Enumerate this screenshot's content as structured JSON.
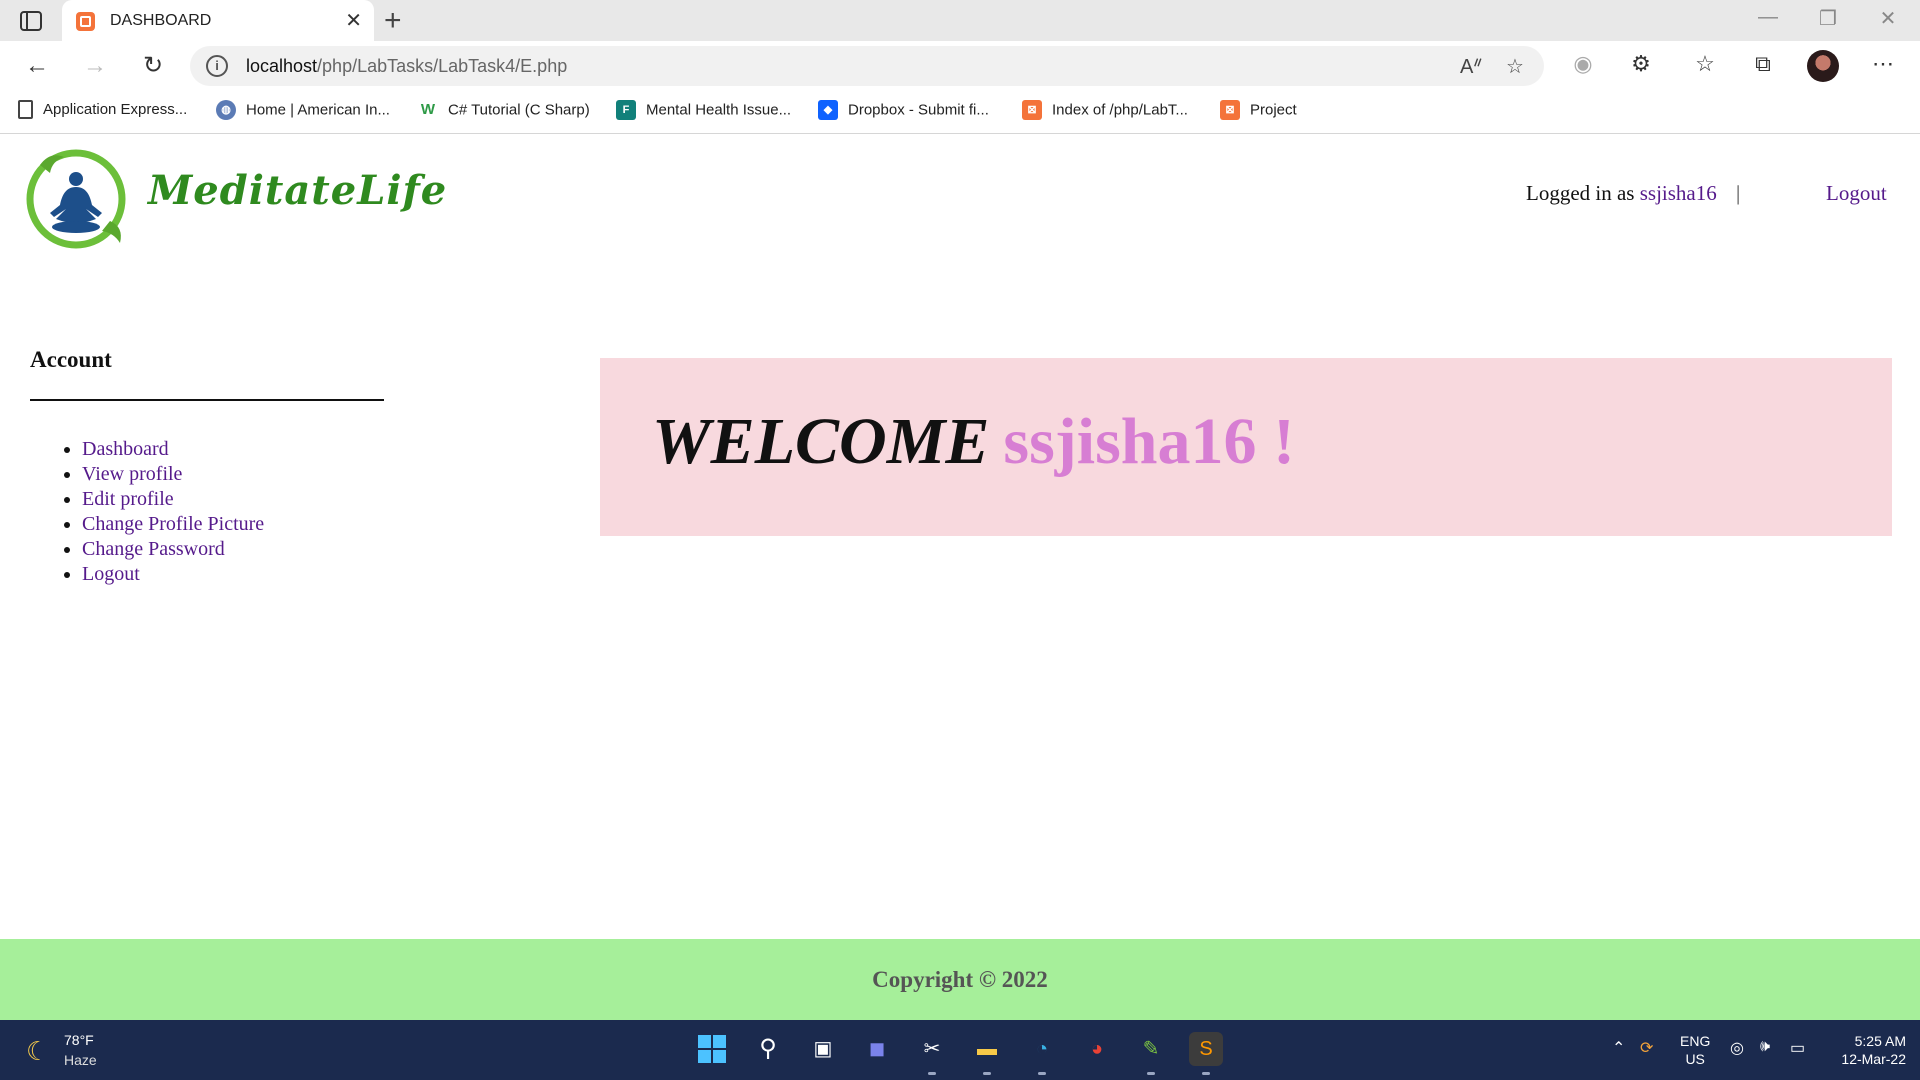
{
  "browser": {
    "tab_title": "DASHBOARD",
    "url_host": "localhost",
    "url_path": "/php/LabTasks/LabTask4/E.php",
    "bookmarks": [
      {
        "label": "Application Express...",
        "icon": "page-icon"
      },
      {
        "label": "Home | American In...",
        "icon": "globe-icon"
      },
      {
        "label": "C# Tutorial (C Sharp)",
        "icon": "w3schools-icon"
      },
      {
        "label": "Mental Health Issue...",
        "icon": "forms-icon"
      },
      {
        "label": "Dropbox - Submit fi...",
        "icon": "dropbox-icon"
      },
      {
        "label": "Index of /php/LabT...",
        "icon": "xampp-icon"
      },
      {
        "label": "Project",
        "icon": "xampp-icon"
      }
    ]
  },
  "header": {
    "logo_text": "MeditateLife",
    "logged_in_prefix": "Logged in as",
    "username": "ssjisha16",
    "separator": "|",
    "logout": "Logout"
  },
  "sidebar": {
    "title": "Account",
    "items": [
      {
        "label": "Dashboard"
      },
      {
        "label": "View profile"
      },
      {
        "label": "Edit profile"
      },
      {
        "label": "Change Profile Picture"
      },
      {
        "label": "Change Password"
      },
      {
        "label": "Logout"
      }
    ]
  },
  "welcome": {
    "word": "WELCOME",
    "name": "ssjisha16 !"
  },
  "footer": {
    "copyright": "Copyright © 2022"
  },
  "taskbar": {
    "temp": "78°F",
    "condition": "Haze",
    "lang_line1": "ENG",
    "lang_line2": "US",
    "time": "5:25 AM",
    "date": "12-Mar-22"
  },
  "colors": {
    "welcome_bg": "#f8d9de",
    "welcome_name": "#d77ed3",
    "footer_bg": "#a6ef9a",
    "link": "#551a8b",
    "logo_green": "#2f8a1f"
  }
}
